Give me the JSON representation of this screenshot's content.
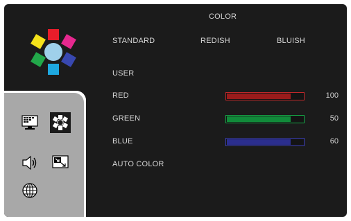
{
  "menu": {
    "title": "COLOR",
    "presets": [
      "STANDARD",
      "REDISH",
      "BLUISH"
    ],
    "user_label": "USER",
    "channels": [
      {
        "label": "RED",
        "value": "100",
        "level": 0.82,
        "color": "#9a1b1b",
        "border": "#c0282a"
      },
      {
        "label": "GREEN",
        "value": "50",
        "level": 0.82,
        "color": "#118a3a",
        "border": "#14a846"
      },
      {
        "label": "BLUE",
        "value": "60",
        "level": 0.82,
        "color": "#2b2e8e",
        "border": "#3b3fb4"
      }
    ],
    "auto_color_label": "AUTO COLOR"
  },
  "sidebar": {
    "icons": [
      "picture-icon",
      "color-icon",
      "audio-icon",
      "image-setup-icon",
      "language-icon"
    ],
    "selected": "color-icon"
  },
  "colors": {
    "panel_bg": "#1b1b1b",
    "sidebar_bg": "#a8a8a8",
    "text": "#d8d8d8"
  }
}
